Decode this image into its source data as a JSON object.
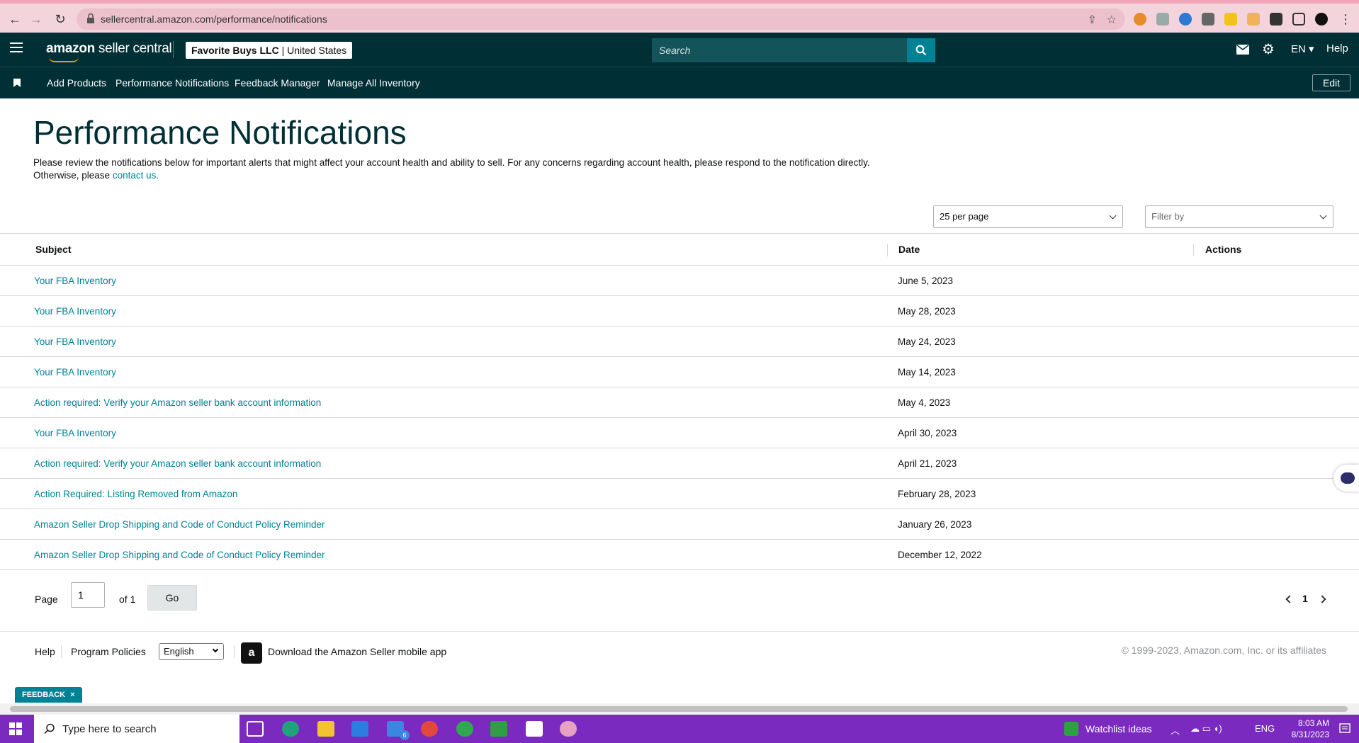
{
  "browser": {
    "url": "sellercentral.amazon.com/performance/notifications"
  },
  "header": {
    "logo_main": "amazon",
    "logo_sub": " seller central",
    "account_name": "Favorite Buys LLC",
    "account_region": " | United States",
    "search_placeholder": "Search",
    "language": "EN",
    "help": "Help"
  },
  "nav": {
    "links": [
      "Add Products",
      "Performance Notifications",
      "Feedback Manager",
      "Manage All Inventory"
    ],
    "edit": "Edit"
  },
  "main": {
    "title": "Performance Notifications",
    "description": "Please review the notifications below for important alerts that might affect your account health and ability to sell. For any concerns regarding account health, please respond to the notification directly. Otherwise, please ",
    "contact_link": "contact us.",
    "per_page": "25 per page",
    "filter_placeholder": "Filter by"
  },
  "table": {
    "headers": {
      "subject": "Subject",
      "date": "Date",
      "actions": "Actions"
    },
    "rows": [
      {
        "subject": "Your FBA Inventory",
        "date": "June 5, 2023"
      },
      {
        "subject": "Your FBA Inventory",
        "date": "May 28, 2023"
      },
      {
        "subject": "Your FBA Inventory",
        "date": "May 24, 2023"
      },
      {
        "subject": "Your FBA Inventory",
        "date": "May 14, 2023"
      },
      {
        "subject": "Action required: Verify your Amazon seller bank account information",
        "date": "May 4, 2023"
      },
      {
        "subject": "Your FBA Inventory",
        "date": "April 30, 2023"
      },
      {
        "subject": "Action required: Verify your Amazon seller bank account information",
        "date": "April 21, 2023"
      },
      {
        "subject": "Action Required: Listing Removed from Amazon",
        "date": "February 28, 2023"
      },
      {
        "subject": "Amazon Seller Drop Shipping and Code of Conduct Policy Reminder",
        "date": "January 26, 2023"
      },
      {
        "subject": "Amazon Seller Drop Shipping and Code of Conduct Policy Reminder",
        "date": "December 12, 2022"
      }
    ]
  },
  "pagination": {
    "page_label": "Page",
    "page_value": "1",
    "of_label": "of 1",
    "go": "Go",
    "current": "1"
  },
  "footer": {
    "help": "Help",
    "policies": "Program Policies",
    "language": "English",
    "app_text": "Download the Amazon Seller mobile app",
    "copyright": "© 1999-2023, Amazon.com, Inc. or its affiliates"
  },
  "feedback": {
    "label": "FEEDBACK",
    "close": "×"
  },
  "taskbar": {
    "search_text": "Type here to search",
    "watchlist": "Watchlist ideas",
    "lang": "ENG",
    "time": "8:03 AM",
    "date": "8/31/2023",
    "mail_badge": "6"
  },
  "colors": {
    "header_bg": "#002f36",
    "link": "#008296",
    "taskbar": "#7b2abf"
  }
}
